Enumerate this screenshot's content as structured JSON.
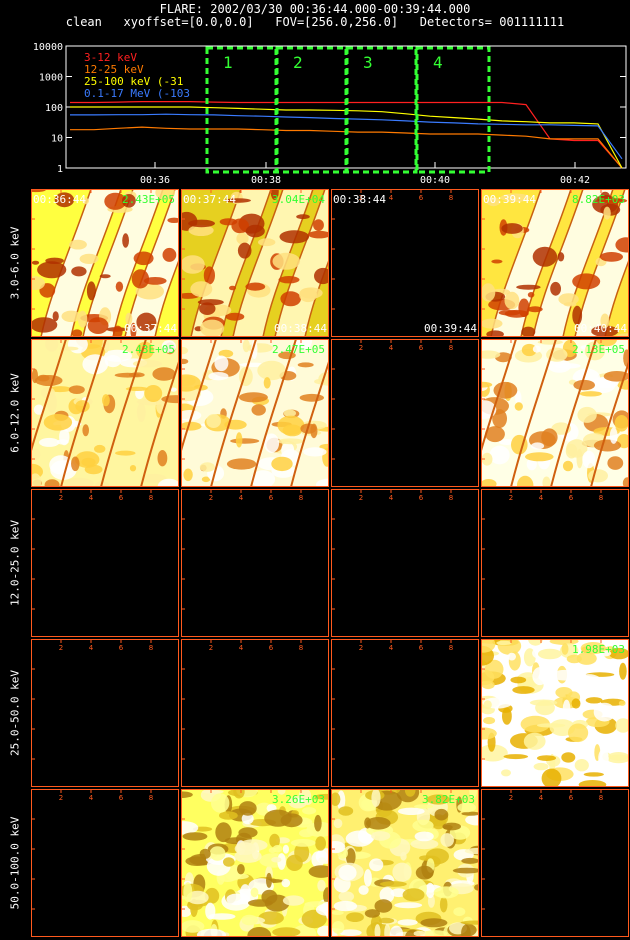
{
  "header": {
    "line1": "FLARE: 2002/03/30 00:36:44.000-00:39:44.000",
    "line2": "clean   xyoffset=[0.0,0.0]   FOV=[256.0,256.0]   Detectors= 001111111"
  },
  "chart_data": {
    "type": "line",
    "y_scale": "log",
    "ylim": [
      1,
      10000
    ],
    "y_ticks": [
      "10000",
      "1000",
      "100",
      "10",
      "1"
    ],
    "x_ticks": [
      "00:36",
      "00:38",
      "00:40",
      "00:42"
    ],
    "legend": [
      "3-12 keV",
      "12-25 keV",
      "25-100 keV (-31",
      "0.1-17 MeV (-103"
    ],
    "colors": [
      "#ff2020",
      "#ff7a00",
      "#ffff00",
      "#3a7bff"
    ],
    "interval_labels": [
      "1",
      "2",
      "3",
      "4"
    ],
    "series": [
      {
        "name": "3-12 keV",
        "values": [
          140,
          140,
          145,
          150,
          150,
          150,
          145,
          140,
          140,
          140,
          140,
          140,
          140,
          140,
          140,
          140,
          140,
          140,
          140,
          120,
          9,
          8,
          8,
          1
        ]
      },
      {
        "name": "12-25 keV",
        "values": [
          18,
          18,
          20,
          22,
          20,
          19,
          19,
          19,
          18,
          17,
          17,
          16,
          15,
          15,
          14,
          13,
          13,
          13,
          12,
          11,
          9,
          9,
          9,
          1
        ]
      },
      {
        "name": "25-100 keV (-31",
        "values": [
          100,
          100,
          100,
          100,
          100,
          100,
          95,
          90,
          85,
          80,
          80,
          78,
          75,
          70,
          60,
          50,
          45,
          40,
          35,
          33,
          30,
          30,
          28,
          1
        ]
      },
      {
        "name": "0.1-17 MeV (-103",
        "values": [
          55,
          55,
          56,
          56,
          58,
          56,
          55,
          52,
          50,
          47,
          45,
          42,
          40,
          38,
          35,
          32,
          30,
          28,
          27,
          26,
          26,
          25,
          24,
          2
        ]
      }
    ]
  },
  "grid": {
    "rows": [
      {
        "label": "3.0-6.0 keV",
        "cells": [
          {
            "peak": "2.43E+05",
            "time_top": "00:36:44",
            "time_bottom": "00:37:44",
            "variant": "a",
            "shade": "#ffff40",
            "image": true
          },
          {
            "peak": "3.04E+04",
            "time_top": "00:37:44",
            "time_bottom": "00:38:44",
            "variant": "b",
            "shade": "#e6d020",
            "image": true
          },
          {
            "peak": "",
            "time_top": "00:38:44",
            "time_bottom": "00:39:44",
            "variant": "",
            "shade": "",
            "image": false
          },
          {
            "peak": "8.82E+03",
            "time_top": "00:39:44",
            "time_bottom": "00:40:44",
            "variant": "a",
            "shade": "#ffe640",
            "image": true
          }
        ]
      },
      {
        "label": "6.0-12.0 keV",
        "cells": [
          {
            "peak": "2.43E+05",
            "variant": "c",
            "shade": "#fff6a0",
            "image": true
          },
          {
            "peak": "2.47E+05",
            "variant": "d",
            "shade": "#fffbd8",
            "image": true
          },
          {
            "peak": "",
            "variant": "",
            "shade": "",
            "image": false
          },
          {
            "peak": "2.13E+05",
            "variant": "c",
            "shade": "#ffffe6",
            "image": true
          }
        ]
      },
      {
        "label": "12.0-25.0 keV",
        "cells": [
          {
            "peak": "",
            "image": false
          },
          {
            "peak": "",
            "image": false
          },
          {
            "peak": "",
            "image": false
          },
          {
            "peak": "",
            "image": false
          }
        ]
      },
      {
        "label": "25.0-50.0 keV",
        "cells": [
          {
            "peak": "",
            "image": false
          },
          {
            "peak": "",
            "image": false
          },
          {
            "peak": "",
            "image": false
          },
          {
            "peak": "1.98E+03",
            "variant": "e",
            "shade": "#fff8b0",
            "image": true
          }
        ]
      },
      {
        "label": "50.0-100.0 keV",
        "cells": [
          {
            "peak": "",
            "image": false
          },
          {
            "peak": "3.26E+03",
            "variant": "f",
            "shade": "#ffff60",
            "image": true
          },
          {
            "peak": "3.82E+03",
            "variant": "f",
            "shade": "#fff070",
            "image": true
          },
          {
            "peak": "",
            "image": false
          }
        ]
      }
    ],
    "axis_ticks": [
      "2",
      "4",
      "6",
      "8"
    ]
  }
}
